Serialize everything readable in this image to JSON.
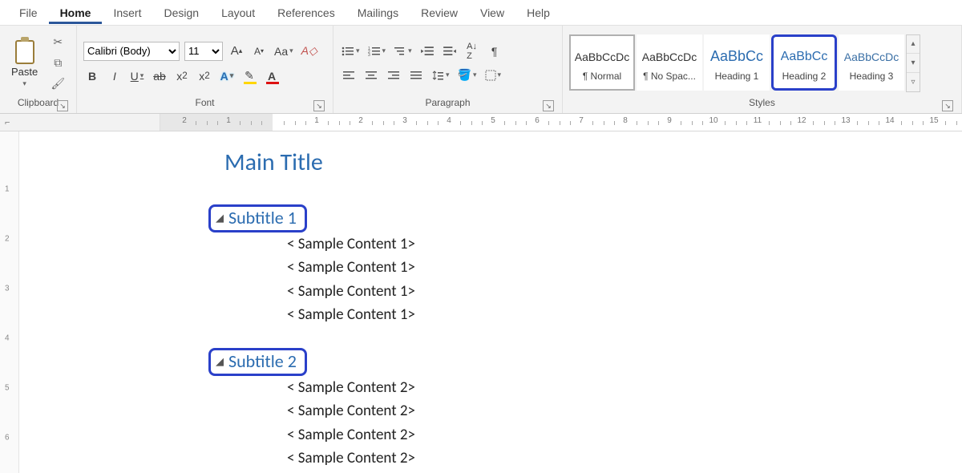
{
  "tabs": {
    "file": "File",
    "home": "Home",
    "insert": "Insert",
    "design": "Design",
    "layout": "Layout",
    "references": "References",
    "mailings": "Mailings",
    "review": "Review",
    "view": "View",
    "help": "Help"
  },
  "ribbon": {
    "clipboard": {
      "paste": "Paste",
      "label": "Clipboard"
    },
    "font": {
      "name": "Calibri (Body)",
      "size": "11",
      "label": "Font",
      "change_case": "Aa"
    },
    "paragraph": {
      "label": "Paragraph"
    },
    "styles": {
      "label": "Styles",
      "sample": "AaBbCcDc",
      "sample_heading": "AaBbCc",
      "items": [
        {
          "name": "¶ Normal"
        },
        {
          "name": "¶ No Spac..."
        },
        {
          "name": "Heading 1"
        },
        {
          "name": "Heading 2"
        },
        {
          "name": "Heading 3"
        }
      ]
    }
  },
  "ruler": {
    "h": [
      "2",
      "1",
      "",
      "1",
      "2",
      "3",
      "4",
      "5",
      "6",
      "7",
      "8",
      "9",
      "10",
      "11",
      "12",
      "13",
      "14",
      "15"
    ],
    "v": [
      "",
      "1",
      "2",
      "3",
      "4",
      "5",
      "6"
    ]
  },
  "document": {
    "title": "Main Title",
    "sections": [
      {
        "subtitle": "Subtitle 1",
        "lines": [
          "< Sample Content 1>",
          "< Sample Content 1>",
          "< Sample Content 1>",
          "< Sample Content 1>"
        ]
      },
      {
        "subtitle": "Subtitle 2",
        "lines": [
          "< Sample Content 2>",
          "< Sample Content 2>",
          "< Sample Content 2>",
          "< Sample Content 2>"
        ]
      }
    ]
  }
}
